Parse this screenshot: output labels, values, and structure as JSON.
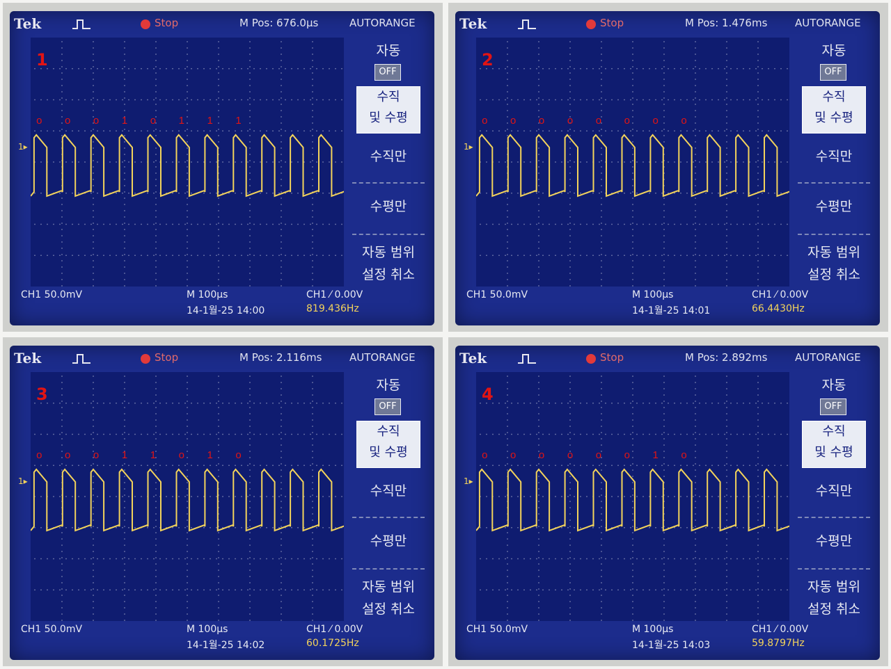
{
  "panels": [
    {
      "number": "1",
      "header": {
        "brand": "Tek",
        "status": "Stop",
        "mpos": "M Pos: 676.0μs",
        "mode": "AUTORANGE"
      },
      "menu": {
        "auto": "자동",
        "off": "OFF",
        "both_line1": "수직",
        "both_line2": "및 수평",
        "vertical": "수직만",
        "horizontal": "수평만",
        "autoset": "자동 범위",
        "cancel": "설정 취소"
      },
      "footer": {
        "ch1": "CH1  50.0mV",
        "timebase": "M 100μs",
        "trigger": "CH1 ⁄ 0.00V",
        "datetime": "14-1월-25 14:00",
        "frequency": "819.436Hz"
      },
      "annotations": [
        "o",
        "o",
        "o",
        "1",
        "o",
        "1",
        "1",
        "1"
      ]
    },
    {
      "number": "2",
      "header": {
        "brand": "Tek",
        "status": "Stop",
        "mpos": "M Pos: 1.476ms",
        "mode": "AUTORANGE"
      },
      "menu": {
        "auto": "자동",
        "off": "OFF",
        "both_line1": "수직",
        "both_line2": "및 수평",
        "vertical": "수직만",
        "horizontal": "수평만",
        "autoset": "자동 범위",
        "cancel": "설정 취소"
      },
      "footer": {
        "ch1": "CH1  50.0mV",
        "timebase": "M 100μs",
        "trigger": "CH1 ⁄ 0.00V",
        "datetime": "14-1월-25 14:01",
        "frequency": "66.4430Hz"
      },
      "annotations": [
        "o",
        "o",
        "o",
        "o",
        "o",
        "o",
        "o",
        "o"
      ]
    },
    {
      "number": "3",
      "header": {
        "brand": "Tek",
        "status": "Stop",
        "mpos": "M Pos: 2.116ms",
        "mode": "AUTORANGE"
      },
      "menu": {
        "auto": "자동",
        "off": "OFF",
        "both_line1": "수직",
        "both_line2": "및 수평",
        "vertical": "수직만",
        "horizontal": "수평만",
        "autoset": "자동 범위",
        "cancel": "설정 취소"
      },
      "footer": {
        "ch1": "CH1  50.0mV",
        "timebase": "M 100μs",
        "trigger": "CH1 ⁄ 0.00V",
        "datetime": "14-1월-25 14:02",
        "frequency": "60.1725Hz"
      },
      "annotations": [
        "o",
        "o",
        "o",
        "1",
        "1",
        "o",
        "1",
        "o"
      ]
    },
    {
      "number": "4",
      "header": {
        "brand": "Tek",
        "status": "Stop",
        "mpos": "M Pos: 2.892ms",
        "mode": "AUTORANGE"
      },
      "menu": {
        "auto": "자동",
        "off": "OFF",
        "both_line1": "수직",
        "both_line2": "및 수평",
        "vertical": "수직만",
        "horizontal": "수평만",
        "autoset": "자동 범위",
        "cancel": "설정 취소"
      },
      "footer": {
        "ch1": "CH1  50.0mV",
        "timebase": "M 100μs",
        "trigger": "CH1 ⁄ 0.00V",
        "datetime": "14-1월-25 14:03",
        "frequency": "59.8797Hz"
      },
      "annotations": [
        "o",
        "o",
        "o",
        "o",
        "o",
        "o",
        "1",
        "o"
      ]
    }
  ],
  "colors": {
    "screen": "#1c2c8c",
    "trace": "#f3d35b",
    "annotation": "#e11414",
    "grid_dots": "#c9cce0"
  }
}
